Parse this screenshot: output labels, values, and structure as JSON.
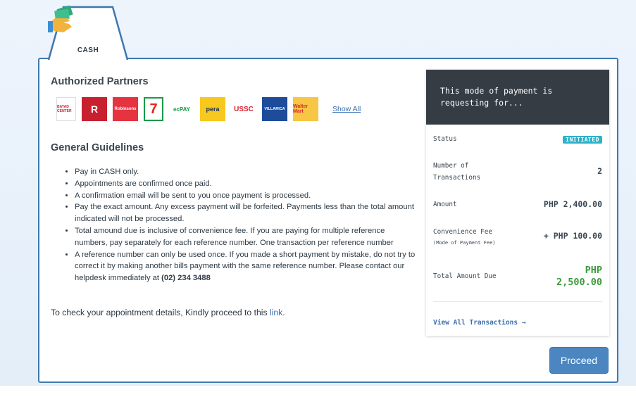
{
  "tab": {
    "label": "CASH",
    "icon": "cash-hand-icon"
  },
  "partners": {
    "title": "Authorized Partners",
    "logos": [
      {
        "name": "bayad-center",
        "text": "BAYAD CENTER",
        "bg": "#ffffff",
        "fg": "#c8202f"
      },
      {
        "name": "robinsons-dept",
        "text": "R",
        "bg": "#c8202f",
        "fg": "#ffffff"
      },
      {
        "name": "robinsons",
        "text": "Robinsons",
        "bg": "#e5333f",
        "fg": "#ffffff"
      },
      {
        "name": "seven-eleven",
        "text": "7",
        "bg": "#ffffff",
        "fg": "#e2231a"
      },
      {
        "name": "ecpay",
        "text": "ecPAY",
        "bg": "#ffffff",
        "fg": "#1a9a4a"
      },
      {
        "name": "perahub",
        "text": "pera",
        "bg": "#f7c81e",
        "fg": "#1b2d55"
      },
      {
        "name": "ussc",
        "text": "USSC",
        "bg": "#ffffff",
        "fg": "#d91f2c"
      },
      {
        "name": "villarica",
        "text": "VILLARICA",
        "bg": "#1e4c9a",
        "fg": "#ffffff"
      },
      {
        "name": "waltermart",
        "text": "Walter Mart",
        "bg": "#f6c644",
        "fg": "#d62b2b"
      }
    ],
    "show_all": "Show All"
  },
  "guidelines": {
    "title": "General Guidelines",
    "items": [
      "Pay in CASH only.",
      "Appointments are confirmed once paid.",
      "A confirmation email will be sent to you once payment is processed.",
      "Pay the exact amount. Any excess payment will be forfeited. Payments less than the total amount indicated will not be processed.",
      "Total amound due is inclusive of convenience fee. If you are paying for multiple reference numbers, pay separately for each reference number. One transaction per reference number",
      "A reference number can only be used once. If you made a short payment by mistake, do not try to correct it by making another bills payment with the same reference number. Please contact our helpdesk immediately at "
    ],
    "helpdesk": "(02) 234 3488",
    "link_prefix": "To check your appointment details, Kindly proceed to this ",
    "link_text": "link",
    "link_suffix": "."
  },
  "summary": {
    "header": "This mode of payment is requesting for...",
    "status_label": "Status",
    "status_value": "INITIATED",
    "transactions_label": "Number of Transactions",
    "transactions_value": "2",
    "amount_label": "Amount",
    "amount_value": "PHP 2,400.00",
    "fee_label": "Convenience Fee",
    "fee_sub": "(Mode of Payment Fee)",
    "fee_value": "+ PHP 100.00",
    "total_label": "Total Amount Due",
    "total_value": "PHP 2,500.00",
    "view_all": "View All Transactions →"
  },
  "proceed_label": "Proceed",
  "colors": {
    "accent": "#3e78ad",
    "button": "#4b86c1",
    "badge": "#2eb1c9",
    "total": "#3d9a3b",
    "header": "#353c44"
  }
}
